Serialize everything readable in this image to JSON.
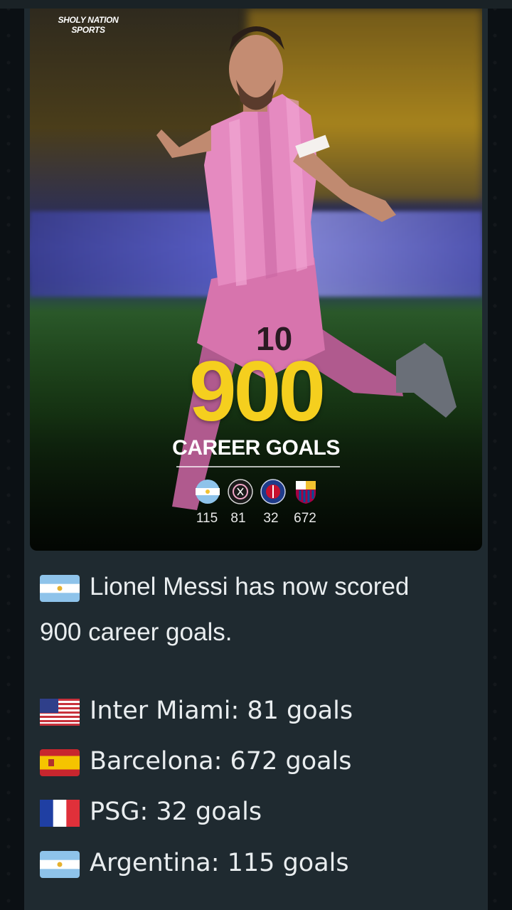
{
  "media": {
    "watermark": "SHOLY NATION\nSPORTS",
    "headline_number": "900",
    "headline_text": "CAREER GOALS",
    "team_goals": [
      "115",
      "81",
      "32",
      "672"
    ],
    "jersey_number": "10"
  },
  "caption": {
    "intro_line1": "Lionel Messi has now scored",
    "intro_line2": "900 career goals.",
    "items": [
      {
        "flag": "flag-usa-icon",
        "text": "Inter Miami: 81 goals"
      },
      {
        "flag": "flag-spain-icon",
        "text": "Barcelona: 672 goals"
      },
      {
        "flag": "flag-france-icon",
        "text": "PSG: 32 goals"
      },
      {
        "flag": "flag-argentina-icon",
        "text": "Argentina: 115 goals"
      }
    ]
  },
  "colors": {
    "accent_yellow": "#f5cf1e",
    "bubble": "#1f2a30",
    "kit_pink": "#e58ac0"
  }
}
